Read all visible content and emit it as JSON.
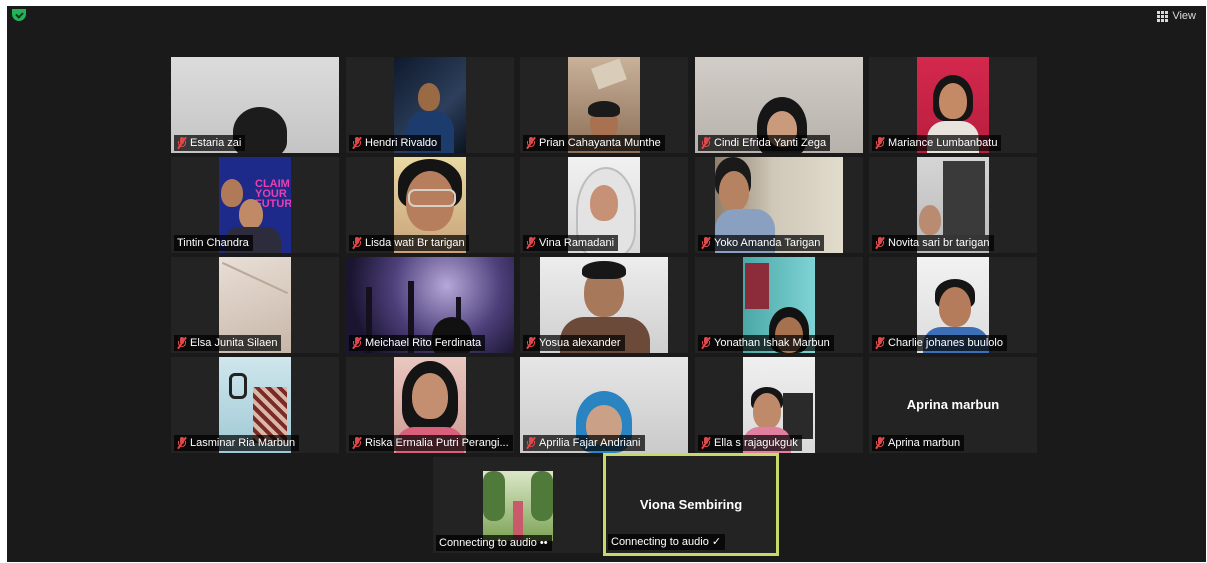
{
  "toolbar": {
    "view_label": "View"
  },
  "participants": [
    {
      "name": "Estaria zai"
    },
    {
      "name": "Hendri Rivaldo"
    },
    {
      "name": "Prian Cahayanta Munthe"
    },
    {
      "name": "Cindi Efrida Yanti Zega"
    },
    {
      "name": "Mariance Lumbanbatu"
    },
    {
      "name": "Tintin Chandra"
    },
    {
      "name": "Lisda wati Br tarigan"
    },
    {
      "name": "Vina Ramadani"
    },
    {
      "name": "Yoko Amanda Tarigan"
    },
    {
      "name": "Novita sari br tarigan"
    },
    {
      "name": "Elsa Junita Silaen"
    },
    {
      "name": "Meichael Rito Ferdinata"
    },
    {
      "name": "Yosua alexander"
    },
    {
      "name": "Yonathan Ishak Marbun"
    },
    {
      "name": "Charlie johanes buulolo"
    },
    {
      "name": "Lasminar Ria Marbun"
    },
    {
      "name": "Riska Ermalia Putri Perangi..."
    },
    {
      "name": "Aprilia Fajar Andriani"
    },
    {
      "name": "Ella s rajagukguk"
    },
    {
      "name": "Aprina marbun",
      "center_name": "Aprina marbun"
    },
    {
      "name": "Connecting to audio ••"
    },
    {
      "name": "Connecting to audio ✓",
      "center_name": "Viona Sembiring"
    }
  ],
  "video_overlay_text": {
    "tintin": "CLAIM YOUR FUTURE"
  }
}
